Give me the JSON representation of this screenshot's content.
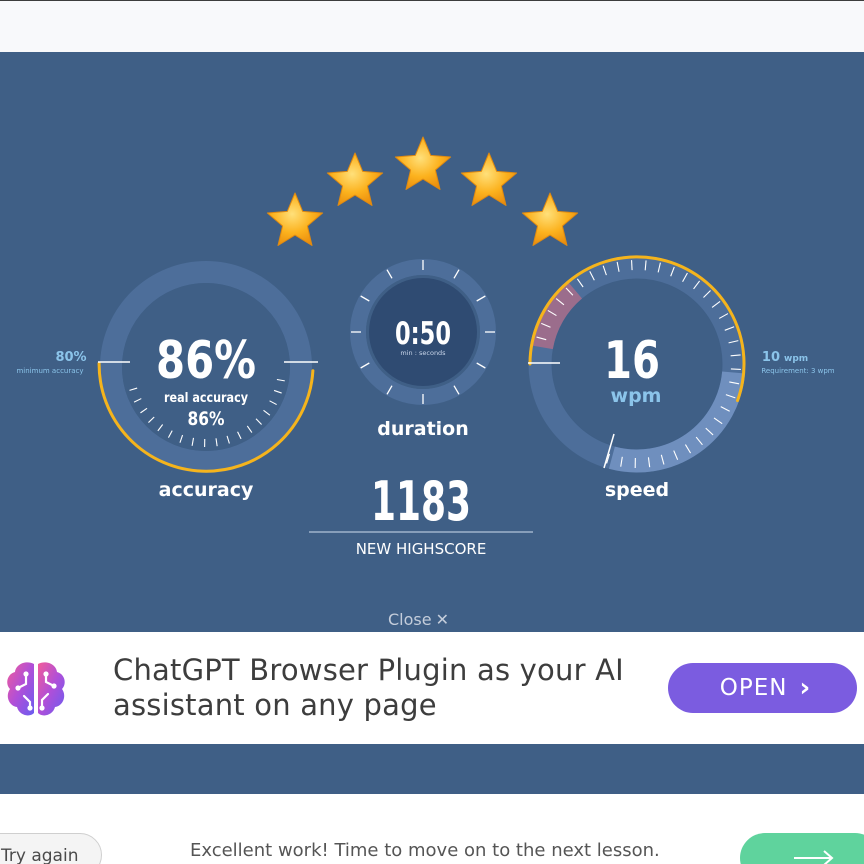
{
  "results": {
    "stars": 5,
    "accuracy": {
      "value": "86%",
      "sub_label": "real accuracy",
      "sub_value": "86%",
      "caption": "accuracy",
      "min_value": "80%",
      "min_label": "minimum accuracy",
      "fraction": 0.86
    },
    "duration": {
      "value": "0:50",
      "unit_label": "min : seconds",
      "caption": "duration"
    },
    "speed": {
      "value": "16",
      "unit": "wpm",
      "caption": "speed",
      "req_value": "10",
      "req_unit": "wpm",
      "req_label": "Requirement: 3 wpm"
    },
    "score": {
      "value": "1183",
      "label": "NEW HIGHSCORE"
    }
  },
  "close": {
    "label": "Close",
    "icon": "close-x-icon"
  },
  "ad": {
    "icon": "brain-icon",
    "text": "ChatGPT Browser Plugin as your AI assistant on any page",
    "button_label": "OPEN"
  },
  "footer": {
    "try_again_label": "Try again",
    "message": "Excellent work! Time to move on to the next lesson.",
    "next_icon": "arrow-right-icon"
  },
  "colors": {
    "panel": "#3f5f86",
    "gold": "#f5b41c",
    "ad_button": "#7b5ce0",
    "next_button": "#5fd39d"
  }
}
